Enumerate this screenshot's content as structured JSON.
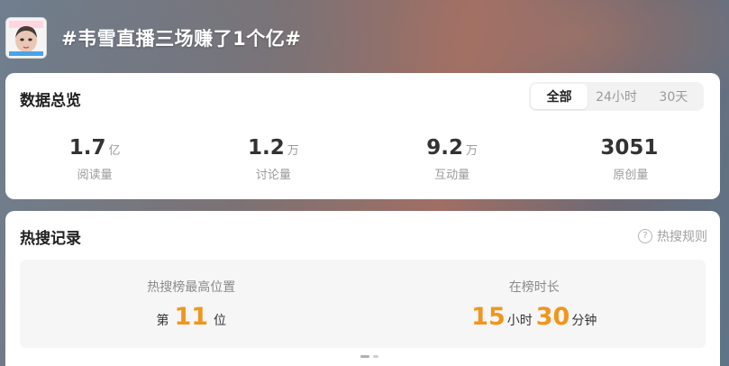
{
  "topic": {
    "title": "#韦雪直播三场赚了1个亿#"
  },
  "overview": {
    "title": "数据总览",
    "tabs": [
      {
        "label": "全部",
        "active": true
      },
      {
        "label": "24小时",
        "active": false
      },
      {
        "label": "30天",
        "active": false
      }
    ],
    "stats": [
      {
        "value": "1.7",
        "unit": "亿",
        "label": "阅读量"
      },
      {
        "value": "1.2",
        "unit": "万",
        "label": "讨论量"
      },
      {
        "value": "9.2",
        "unit": "万",
        "label": "互动量"
      },
      {
        "value": "3051",
        "unit": "",
        "label": "原创量"
      }
    ]
  },
  "hot_search": {
    "title": "热搜记录",
    "rules_label": "热搜规则",
    "help_icon": "question-circle-icon",
    "highest_position": {
      "label": "热搜榜最高位置",
      "prefix": "第",
      "value": "11",
      "suffix": "位"
    },
    "duration": {
      "label": "在榜时长",
      "hours": "15",
      "hours_unit": "小时",
      "minutes": "30",
      "minutes_unit": "分钟"
    }
  },
  "colors": {
    "accent_orange": "#f0961e",
    "card_bg": "#ffffff",
    "muted_text": "#9a9a9a"
  }
}
